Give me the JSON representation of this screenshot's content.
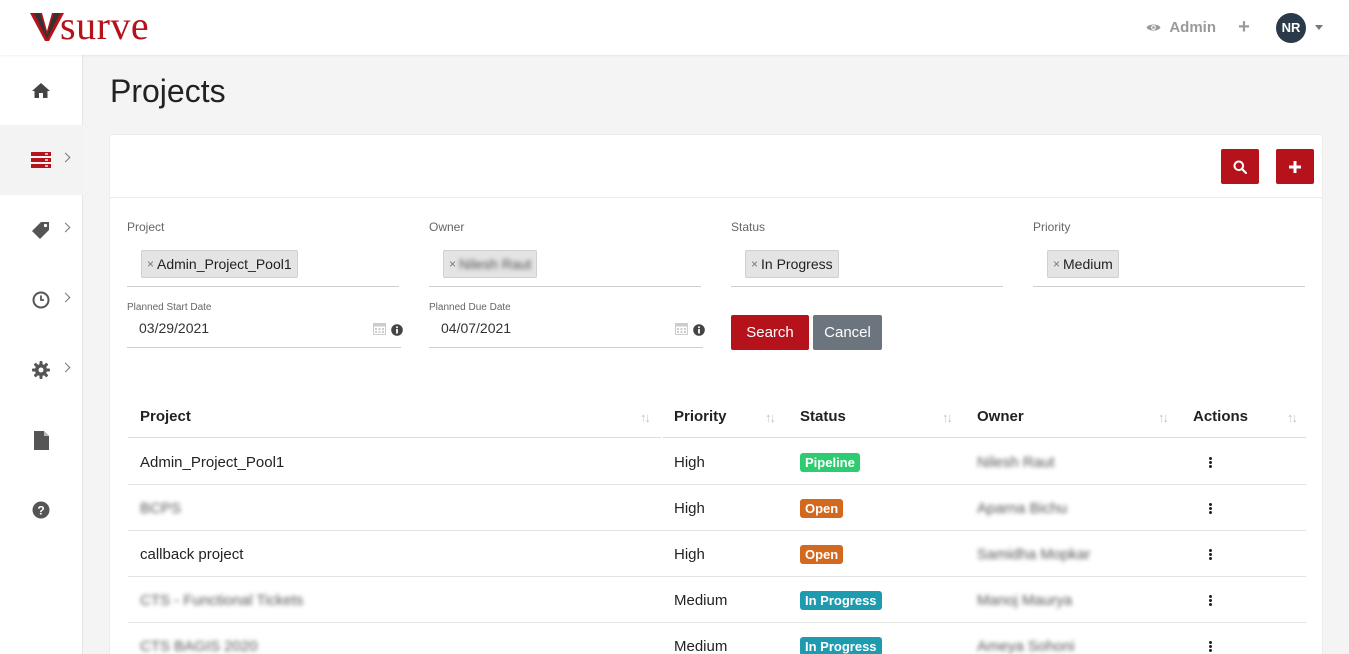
{
  "brand": {
    "logo_text": "surve",
    "color": "#b5121b"
  },
  "topbar": {
    "admin_label": "Admin",
    "add_label": "+",
    "avatar_initials": "NR"
  },
  "sidebar": {
    "items": [
      {
        "icon": "home-icon",
        "active": false
      },
      {
        "icon": "projects-server-icon",
        "active": true
      },
      {
        "icon": "tickets-icon",
        "active": false
      },
      {
        "icon": "clock-icon",
        "active": false
      },
      {
        "icon": "gear-icon",
        "active": false
      },
      {
        "icon": "document-icon",
        "active": false
      },
      {
        "icon": "help-icon",
        "active": false
      }
    ]
  },
  "page": {
    "title": "Projects"
  },
  "filters": {
    "project": {
      "label": "Project",
      "value": "Admin_Project_Pool1"
    },
    "owner": {
      "label": "Owner",
      "value": "Nilesh Raut"
    },
    "status": {
      "label": "Status",
      "value": "In Progress"
    },
    "priority": {
      "label": "Priority",
      "value": "Medium"
    },
    "planned_start": {
      "label": "Planned Start Date",
      "value": "03/29/2021"
    },
    "planned_due": {
      "label": "Planned Due Date",
      "value": "04/07/2021"
    },
    "search_label": "Search",
    "cancel_label": "Cancel"
  },
  "table": {
    "columns": [
      "Project",
      "Priority",
      "Status",
      "Owner",
      "Actions"
    ],
    "rows": [
      {
        "project": "Admin_Project_Pool1",
        "project_blurred": false,
        "priority": "High",
        "status": "Pipeline",
        "owner": "Nilesh Raut"
      },
      {
        "project": "BCPS",
        "project_blurred": true,
        "priority": "High",
        "status": "Open",
        "owner": "Aparna Bichu"
      },
      {
        "project": "callback project",
        "project_blurred": false,
        "priority": "High",
        "status": "Open",
        "owner": "Samidha Mopkar"
      },
      {
        "project": "CTS - Functional Tickets",
        "project_blurred": true,
        "priority": "Medium",
        "status": "In Progress",
        "owner": "Manoj Maurya"
      },
      {
        "project": "CTS BAGIS 2020",
        "project_blurred": true,
        "priority": "Medium",
        "status": "In Progress",
        "owner": "Ameya Sohoni"
      }
    ]
  },
  "status_colors": {
    "Pipeline": "#2ecc71",
    "Open": "#d2691e",
    "In Progress": "#1f9bb0"
  }
}
